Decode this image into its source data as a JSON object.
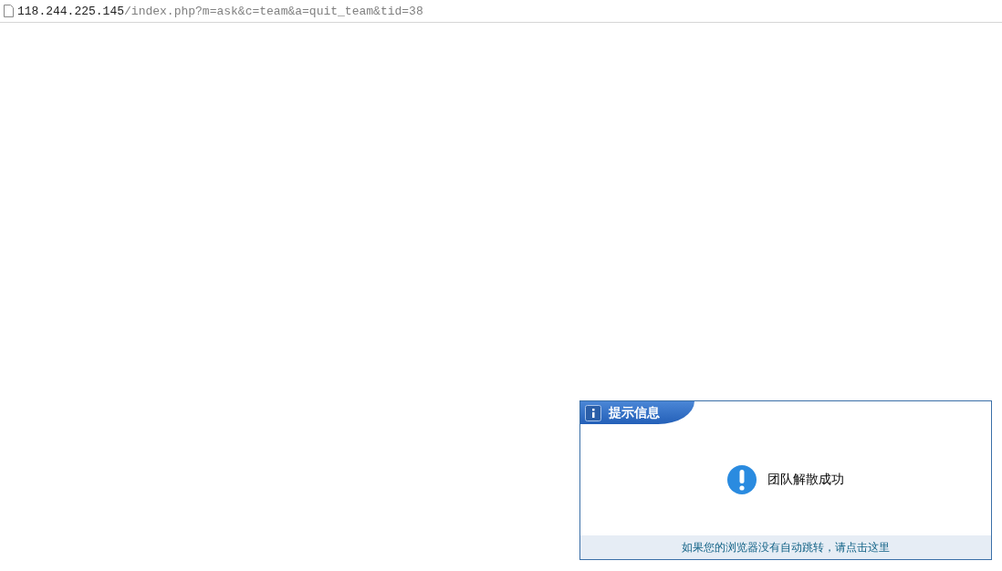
{
  "address_bar": {
    "host": "118.244.225.145",
    "path": "/index.php?m=ask&c=team&a=quit_team&tid=38"
  },
  "dialog": {
    "title": "提示信息",
    "message": "团队解散成功",
    "footer_link": "如果您的浏览器没有自动跳转，请点击这里"
  }
}
